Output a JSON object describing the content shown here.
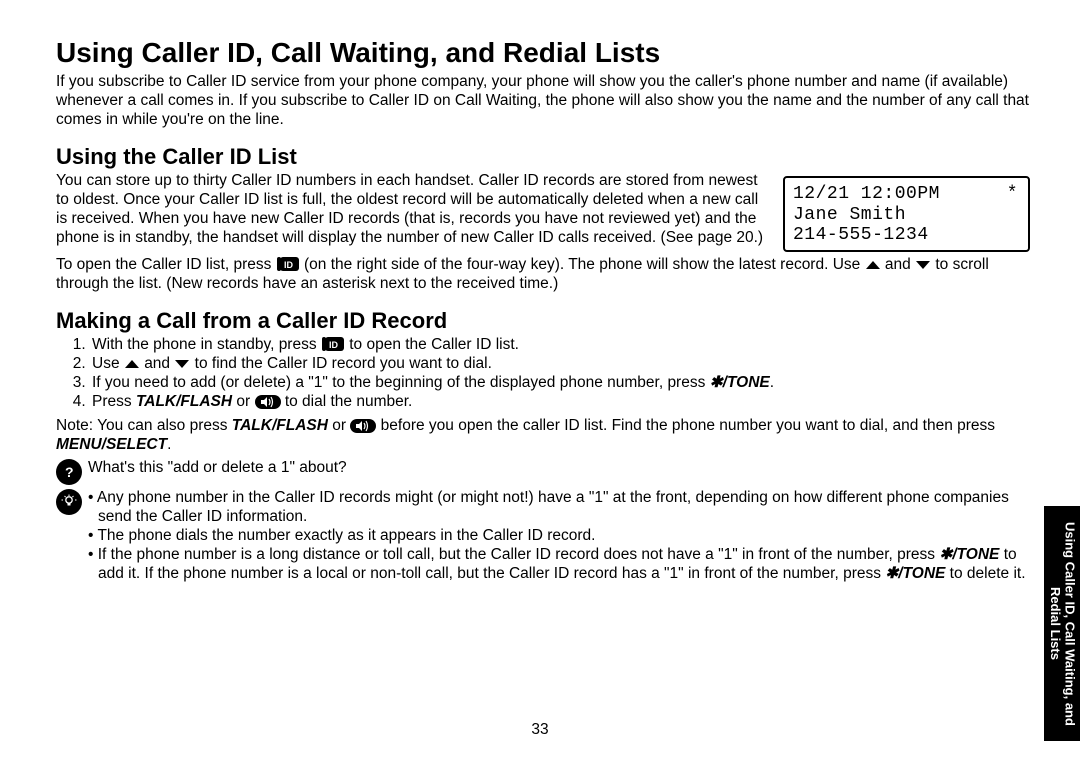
{
  "title": "Using Caller ID, Call Waiting, and Redial Lists",
  "intro": "If you subscribe to Caller ID service from your phone company, your phone will show you the caller's phone number and name (if available) whenever a call comes in. If you subscribe to Caller ID on Call Waiting, the phone will also show you the name and the number of any call that comes in while you're on the line.",
  "lcd": {
    "line1_left": "12/21 12:00PM",
    "line1_right": "*",
    "line2": "Jane Smith",
    "line3": "214-555-1234"
  },
  "section_using": {
    "heading": "Using the Caller ID List",
    "p1": "You can store up to thirty Caller ID numbers in each handset. Caller ID records are stored from newest to oldest. Once your Caller ID list is full, the oldest record will be automatically deleted when a new call is received. When you have new Caller ID records (that is, records you have not reviewed yet) and the phone is in standby, the handset will display the number of new Caller ID calls received. (See page 20.)",
    "p2_a": "To open the Caller ID list, press ",
    "p2_b": " (on the right side of the four-way key). The phone will show the latest record. Use ",
    "p2_c": " and ",
    "p2_d": " to scroll through the list. (New records have an asterisk next to the received time.)"
  },
  "section_making": {
    "heading": "Making a Call from a Caller ID Record",
    "step1_a": "With the phone in standby, press ",
    "step1_b": " to open the Caller ID list.",
    "step2_a": "Use ",
    "step2_b": " and ",
    "step2_c": " to find the Caller ID record you want to dial.",
    "step3_a": "If you need to add (or delete) a \"1\" to the beginning of the displayed phone number, press ",
    "step3_key": "✱/TONE",
    "step3_b": ".",
    "step4_a": "Press ",
    "step4_key": "TALK/FLASH",
    "step4_b": " or ",
    "step4_c": " to dial the number.",
    "note_a": "Note:  You can also press ",
    "note_key1": "TALK/FLASH",
    "note_b": " or ",
    "note_c": " before you open the caller ID list. Find the phone number you want to dial, and then press ",
    "note_key2": "MENU/SELECT",
    "note_d": ".",
    "q_text": "What's this \"add or delete a 1\" about?",
    "bul1": "Any phone number in the Caller ID records might (or might not!) have a \"1\" at the front, depending on how different phone companies send the Caller ID information.",
    "bul2": "The phone dials the number exactly as it appears in the Caller ID record.",
    "bul3_a": "If the phone number is a long distance or toll call, but the Caller ID record does not have a \"1\" in front of the number, press ",
    "bul3_key1": "✱/TONE",
    "bul3_b": " to add it. If the phone number is a local or non-toll call, but the Caller ID record has a \"1\" in front of the number, press ",
    "bul3_key2": "✱/TONE",
    "bul3_c": " to delete it."
  },
  "side_tab": "Using Caller ID, Call Waiting, and Redial Lists",
  "page_number": "33",
  "icons": {
    "id_label": "ID"
  }
}
